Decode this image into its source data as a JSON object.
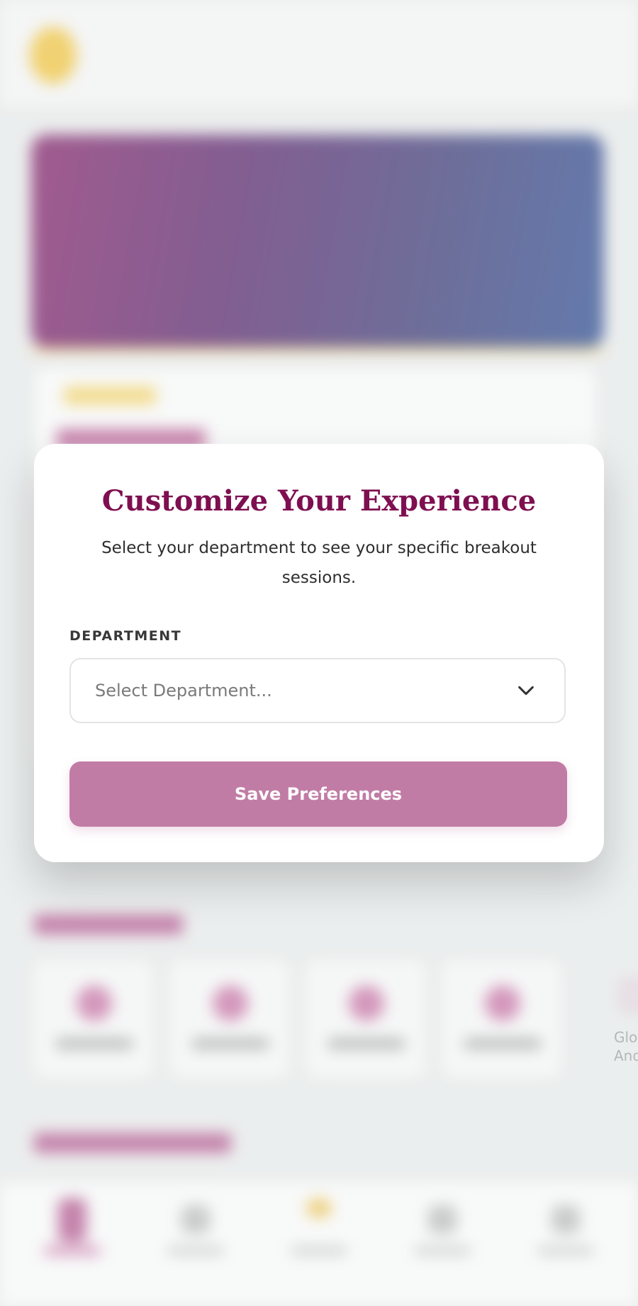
{
  "modal": {
    "title": "Customize Your Experience",
    "description": "Select your department to see your specific breakout sessions.",
    "department_label": "DEPARTMENT",
    "department_placeholder": "Select Department...",
    "save_label": "Save Preferences"
  },
  "background": {
    "partial_tile_label": "Glo\nAnd"
  },
  "colors": {
    "brand": "#7e0f50",
    "button": "#c17ca5",
    "accent": "#f5c330"
  },
  "icons": {
    "select": "chevron-down-icon"
  }
}
